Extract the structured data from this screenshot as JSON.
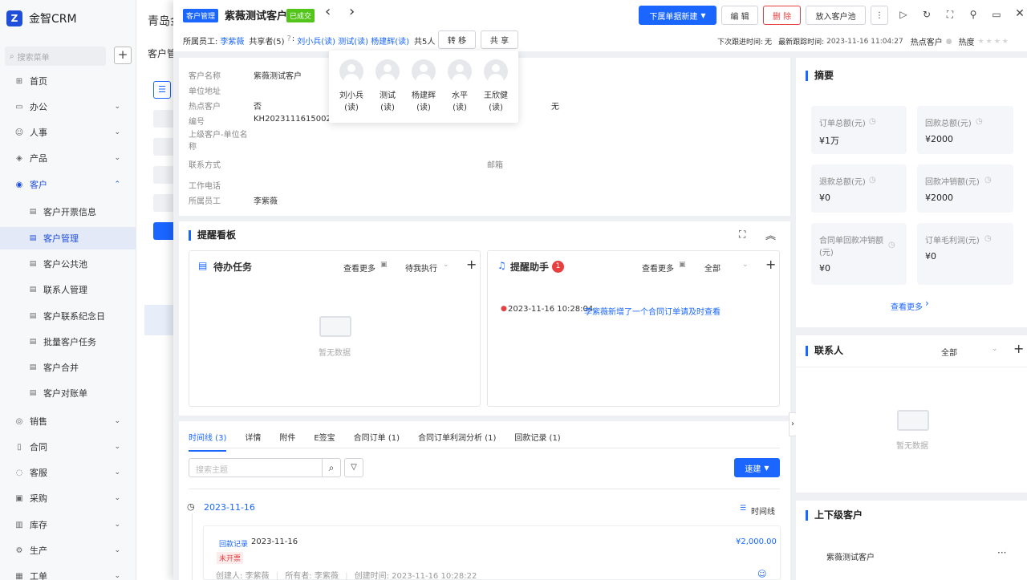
{
  "app": {
    "name": "金智CRM",
    "search_placeholder": "搜索菜单"
  },
  "sidebar": {
    "items": [
      {
        "label": "首页",
        "icon": "home-icon",
        "chevron": ""
      },
      {
        "label": "办公",
        "icon": "office-icon",
        "chevron": "⌄"
      },
      {
        "label": "人事",
        "icon": "people-icon",
        "chevron": "⌄"
      },
      {
        "label": "产品",
        "icon": "product-icon",
        "chevron": "⌄"
      },
      {
        "label": "客户",
        "icon": "customer-icon",
        "chevron": "⌃"
      }
    ],
    "sub_items": [
      {
        "label": "客户开票信息"
      },
      {
        "label": "客户管理"
      },
      {
        "label": "客户公共池"
      },
      {
        "label": "联系人管理"
      },
      {
        "label": "客户联系纪念日"
      },
      {
        "label": "批量客户任务"
      },
      {
        "label": "客户合并"
      },
      {
        "label": "客户对账单"
      }
    ],
    "bottom_items": [
      {
        "label": "销售"
      },
      {
        "label": "合同"
      },
      {
        "label": "客服"
      },
      {
        "label": "采购"
      },
      {
        "label": "库存"
      },
      {
        "label": "生产"
      },
      {
        "label": "工单"
      }
    ]
  },
  "background": {
    "title": "青岛金",
    "tab": "客户管"
  },
  "header": {
    "module_tag": "客户管理",
    "customer_name": "紫薇测试客户",
    "status_tag": "已成交",
    "prev": "‹",
    "next": "›",
    "new_button": "下属单据新建",
    "edit_button": "编 辑",
    "delete_button": "删 除",
    "pool_button": "放入客户池",
    "more_button": "⋮",
    "owner_label": "所属员工:",
    "owner_value": "李紫薇",
    "sharer_label": "共享者(5)",
    "sharer_colon": ":",
    "sharers": "刘小兵(读)  测试(读)  杨建辉(读)",
    "sharer_total": "共5人",
    "transfer_button": "转 移",
    "share_button": "共 享",
    "next_follow_label": "下次跟进时间:",
    "next_follow_value": "无",
    "last_follow_label": "最新跟踪时间:",
    "last_follow_value": "2023-11-16 11:04:27",
    "hot_label": "热点客户",
    "heat_label": "热度"
  },
  "share_popup": {
    "people": [
      {
        "name": "刘小兵",
        "perm": "(读)"
      },
      {
        "name": "测试",
        "perm": "(读)"
      },
      {
        "name": "杨建辉",
        "perm": "(读)"
      },
      {
        "name": "水平",
        "perm": "(读)"
      },
      {
        "name": "王欣健",
        "perm": "(读)"
      }
    ]
  },
  "info": {
    "fields": [
      {
        "label": "客户名称",
        "value": "紫薇测试客户"
      },
      {
        "label": "单位地址",
        "value": ""
      },
      {
        "label": "热点客户",
        "value": "否"
      },
      {
        "label": "编号",
        "value": "KH2023111615002"
      },
      {
        "label": "上级客户-单位名称",
        "value": ""
      },
      {
        "label": "联系方式",
        "value": ""
      },
      {
        "label": "工作电话",
        "value": ""
      },
      {
        "label": "所属员工",
        "value": "李紫薇"
      }
    ],
    "right_value_none": "无",
    "email_label": "邮箱"
  },
  "reminder": {
    "title": "提醒看板",
    "todo": {
      "title": "待办任务",
      "more": "查看更多",
      "filter": "待我执行",
      "empty": "暂无数据"
    },
    "assistant": {
      "title": "提醒助手",
      "badge": "1",
      "more": "查看更多",
      "filter": "全部",
      "entry_time": "2023-11-16 10:28:04",
      "entry_text": "李紫薇新增了一个合同订单请及时查看"
    }
  },
  "timeline": {
    "tabs": [
      "时间线 (3)",
      "详情",
      "附件",
      "E签宝",
      "合同订单 (1)",
      "合同订单利润分析 (1)",
      "回款记录 (1)"
    ],
    "search_placeholder": "搜索主题",
    "quick_button": "速建",
    "date": "2023-11-16",
    "view_label": "时间线",
    "record": {
      "type": "回款记录",
      "date": "2023-11-16",
      "amount": "¥2,000.00",
      "status": "未开票",
      "creator": "创建人: 李紫薇",
      "owner": "所有者: 李紫薇",
      "created_time": "创建时间: 2023-11-16 10:28:22"
    }
  },
  "summary": {
    "title": "摘要",
    "cards": [
      {
        "label": "订单总额(元)",
        "value": "¥1万"
      },
      {
        "label": "回款总额(元)",
        "value": "¥2000"
      },
      {
        "label": "退款总额(元)",
        "value": "¥0"
      },
      {
        "label": "回款冲销额(元)",
        "value": "¥2000"
      },
      {
        "label": "合同单回款冲销额(元)",
        "value": "¥0"
      },
      {
        "label": "订单毛利润(元)",
        "value": "¥0"
      }
    ],
    "more": "查看更多"
  },
  "contacts": {
    "title": "联系人",
    "filter": "全部",
    "empty": "暂无数据"
  },
  "hierarchy": {
    "title": "上下级客户",
    "item": "紫薇测试客户"
  }
}
